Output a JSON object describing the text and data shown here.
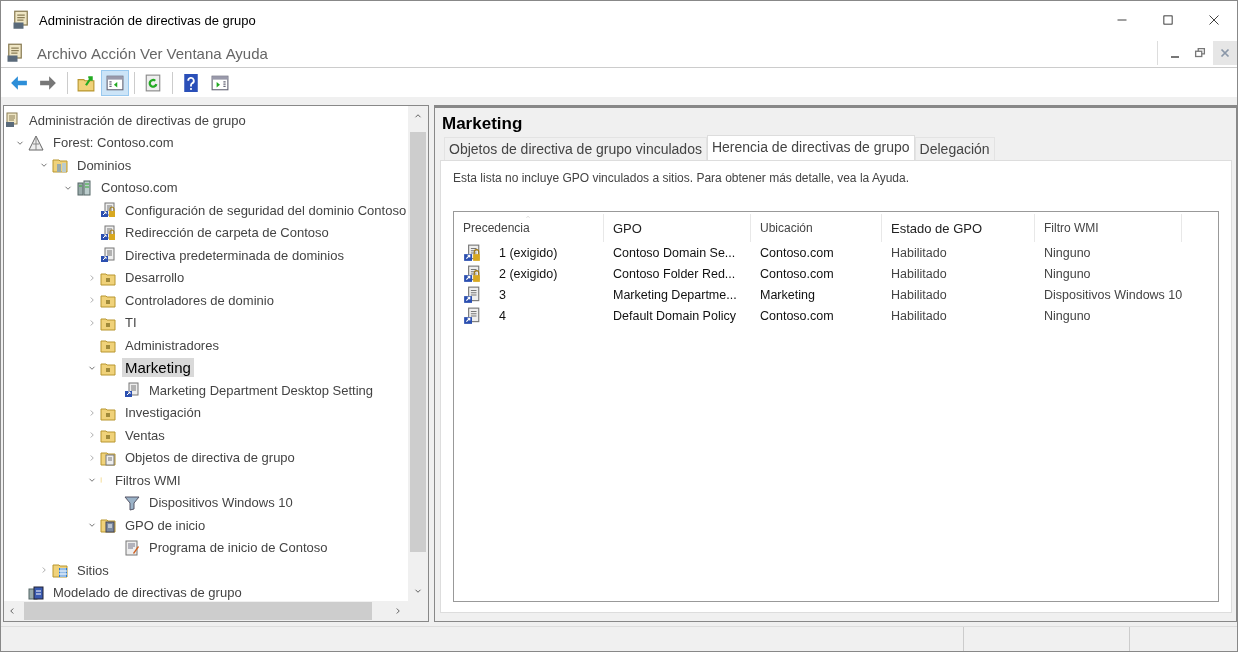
{
  "window": {
    "title": "Administración de directivas de grupo"
  },
  "menu": {
    "items": [
      "Archivo",
      "Acción",
      "Ver",
      "Ventana",
      "Ayuda"
    ]
  },
  "toolbar": [
    {
      "kind": "back",
      "selected": false
    },
    {
      "kind": "forward",
      "selected": false
    },
    {
      "kind": "sep"
    },
    {
      "kind": "up",
      "selected": false
    },
    {
      "kind": "pane",
      "selected": true
    },
    {
      "kind": "sep"
    },
    {
      "kind": "refresh",
      "selected": false
    },
    {
      "kind": "sep"
    },
    {
      "kind": "help",
      "selected": false
    },
    {
      "kind": "action",
      "selected": false
    }
  ],
  "tree": {
    "root": {
      "label": "Administración de directivas de grupo",
      "kind": "root",
      "selected": false,
      "children": [
        {
          "label": "Forest: Contoso.com",
          "kind": "forest",
          "expanded": true,
          "selected": false,
          "children": [
            {
              "label": "Dominios",
              "kind": "domains",
              "expanded": true,
              "selected": false,
              "children": [
                {
                  "label": "Contoso.com",
                  "kind": "domain",
                  "expanded": true,
                  "selected": false,
                  "children": [
                    {
                      "label": "Configuración de seguridad del dominio Contoso",
                      "kind": "link-lock",
                      "selected": false
                    },
                    {
                      "label": "Redirección de carpeta de Contoso",
                      "kind": "link-lock",
                      "selected": false
                    },
                    {
                      "label": "Directiva predeterminada de dominios",
                      "kind": "link",
                      "selected": false
                    },
                    {
                      "label": "Desarrollo",
                      "kind": "ou",
                      "expanded": false,
                      "selected": false
                    },
                    {
                      "label": "Controladores de dominio",
                      "kind": "ou",
                      "expanded": false,
                      "selected": false
                    },
                    {
                      "label": "TI",
                      "kind": "ou",
                      "expanded": false,
                      "selected": false
                    },
                    {
                      "label": "Administradores",
                      "kind": "ou",
                      "selected": false
                    },
                    {
                      "label": "Marketing",
                      "kind": "ou",
                      "expanded": true,
                      "selected": true,
                      "children": [
                        {
                          "label": "Marketing Department Desktop Setting",
                          "kind": "link",
                          "selected": false
                        }
                      ]
                    },
                    {
                      "label": "Investigación",
                      "kind": "ou",
                      "expanded": false,
                      "selected": false
                    },
                    {
                      "label": "Ventas",
                      "kind": "ou",
                      "expanded": false,
                      "selected": false
                    },
                    {
                      "label": "Objetos de directiva de grupo",
                      "kind": "gpo-folder",
                      "expanded": false,
                      "selected": false
                    },
                    {
                      "label": "Filtros WMI",
                      "kind": "bar",
                      "expanded": true,
                      "selected": false,
                      "children": [
                        {
                          "label": "Dispositivos Windows 10",
                          "kind": "filter",
                          "selected": false
                        }
                      ]
                    },
                    {
                      "label": "GPO de inicio",
                      "kind": "starter-folder",
                      "expanded": true,
                      "selected": false,
                      "children": [
                        {
                          "label": "Programa de inicio de Contoso",
                          "kind": "starter",
                          "selected": false
                        }
                      ]
                    }
                  ]
                }
              ]
            },
            {
              "label": "Sitios",
              "kind": "sites",
              "expanded": false,
              "selected": false
            }
          ]
        },
        {
          "label": "Modelado de directivas de grupo",
          "kind": "modeling",
          "selected": false
        }
      ]
    }
  },
  "detail": {
    "title": "Marketing",
    "tabs": [
      {
        "label": "Objetos de directiva de grupo vinculados",
        "selected": false
      },
      {
        "label": "Herencia de directivas de grupo",
        "selected": true
      },
      {
        "label": "Delegación",
        "selected": false
      }
    ],
    "note": "Esta lista no incluye GPO vinculados a sitios. Para obtener más detalle, vea la Ayuda.",
    "table": {
      "columns": [
        "Precedencia",
        "GPO",
        "Ubicación",
        "Estado de GPO",
        "Filtro WMI"
      ],
      "rows": [
        {
          "kind": "enforced",
          "precedence": "1 (exigido)",
          "gpo": "Contoso Domain Se...",
          "location": "Contoso.com",
          "status": "Habilitado",
          "wmi": "Ninguno"
        },
        {
          "kind": "enforced",
          "precedence": "2 (exigido)",
          "gpo": "Contoso Folder Red...",
          "location": "Contoso.com",
          "status": "Habilitado",
          "wmi": "Ninguno"
        },
        {
          "kind": "plain",
          "precedence": "3",
          "gpo": "Marketing Departme...",
          "location": "Marketing",
          "status": "Habilitado",
          "wmi": "Dispositivos Windows 10"
        },
        {
          "kind": "plain",
          "precedence": "4",
          "gpo": "Default Domain Policy",
          "location": "Contoso.com",
          "status": "Habilitado",
          "wmi": "Ninguno"
        }
      ]
    }
  }
}
